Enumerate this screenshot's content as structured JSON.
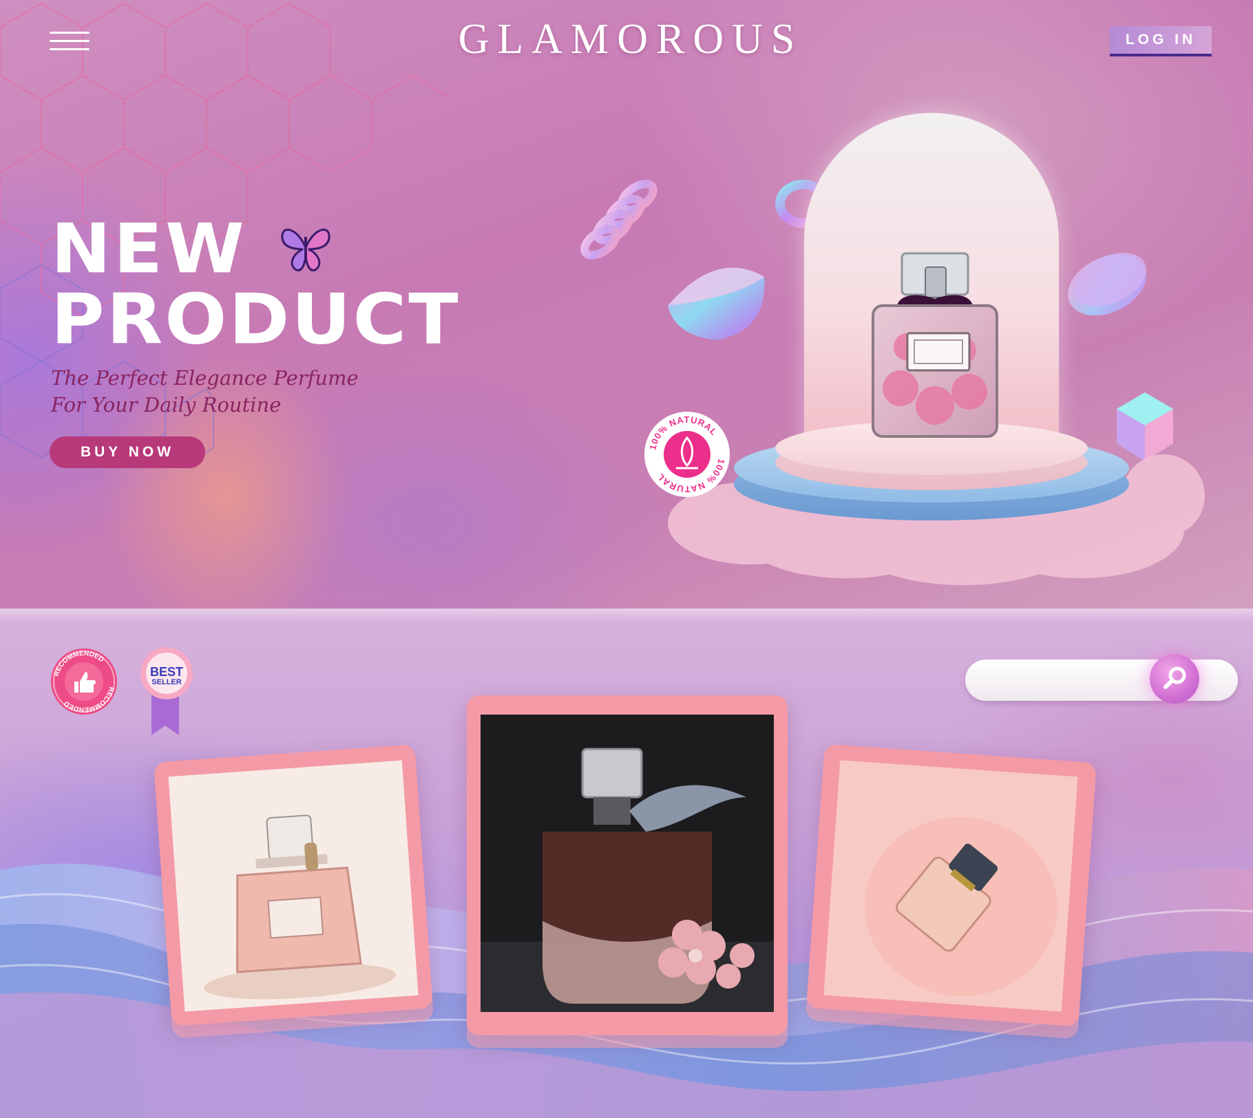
{
  "header": {
    "brand": "GLAMOROUS",
    "menu_icon": "hamburger-menu-icon",
    "login_label": "LOG IN"
  },
  "hero": {
    "headline_line1": "NEW",
    "headline_line2": "PRODUCT",
    "tagline": "The Perfect Elegance Perfume For Your Daily Routine",
    "cta_label": "BUY NOW",
    "badge_text": "100% NATURAL"
  },
  "badges": {
    "recommended": "RECOMMENDED",
    "best": "BEST",
    "seller": "SELLER"
  },
  "search": {
    "placeholder": "",
    "icon": "search-icon"
  },
  "products": [
    {
      "name": "perfume-bottle-cream",
      "background": "#f6e8e0"
    },
    {
      "name": "perfume-bottle-amber",
      "background": "#1e1e20"
    },
    {
      "name": "perfume-bottle-peach",
      "background": "#f7c6c2"
    }
  ],
  "colors": {
    "accent": "#b8397a",
    "tagline": "#8a2460",
    "card": "#f49aa6",
    "login_underline": "#4a2a8a"
  }
}
